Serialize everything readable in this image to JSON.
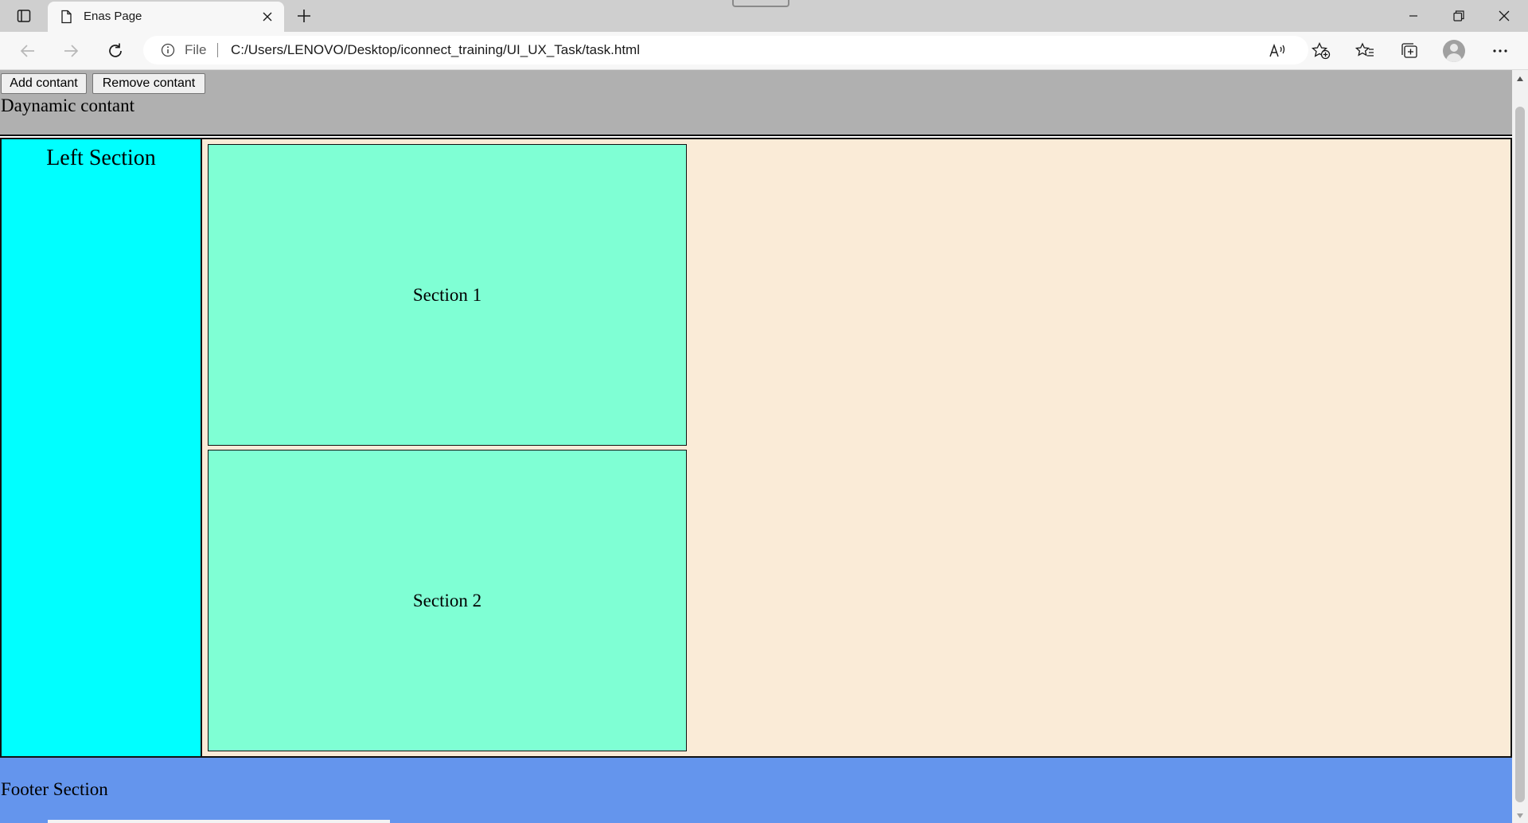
{
  "browser": {
    "tab_title": "Enas Page",
    "address_file_label": "File",
    "url": "C:/Users/LENOVO/Desktop/iconnect_training/UI_UX_Task/task.html"
  },
  "page": {
    "header": {
      "add_button_label": "Add contant",
      "remove_button_label": "Remove contant",
      "dynamic_text": "Daynamic contant"
    },
    "left_section_title": "Left Section",
    "section1_label": "Section 1",
    "section2_label": "Section 2",
    "footer_text": "Footer Section"
  },
  "colors": {
    "header_bg": "#b0b0b0",
    "left_section_bg": "#00ffff",
    "main_bg": "#faebd7",
    "section_bg": "#7fffd4",
    "footer_bg": "#6495ed"
  },
  "icons": [
    "tab-actions-icon",
    "page-icon",
    "close-icon",
    "plus-icon",
    "minimize-icon",
    "restore-icon",
    "back-arrow-icon",
    "forward-arrow-icon",
    "refresh-icon",
    "info-icon",
    "read-aloud-icon",
    "add-favorite-icon",
    "favorites-icon",
    "collections-icon",
    "profile-avatar",
    "more-icon"
  ]
}
